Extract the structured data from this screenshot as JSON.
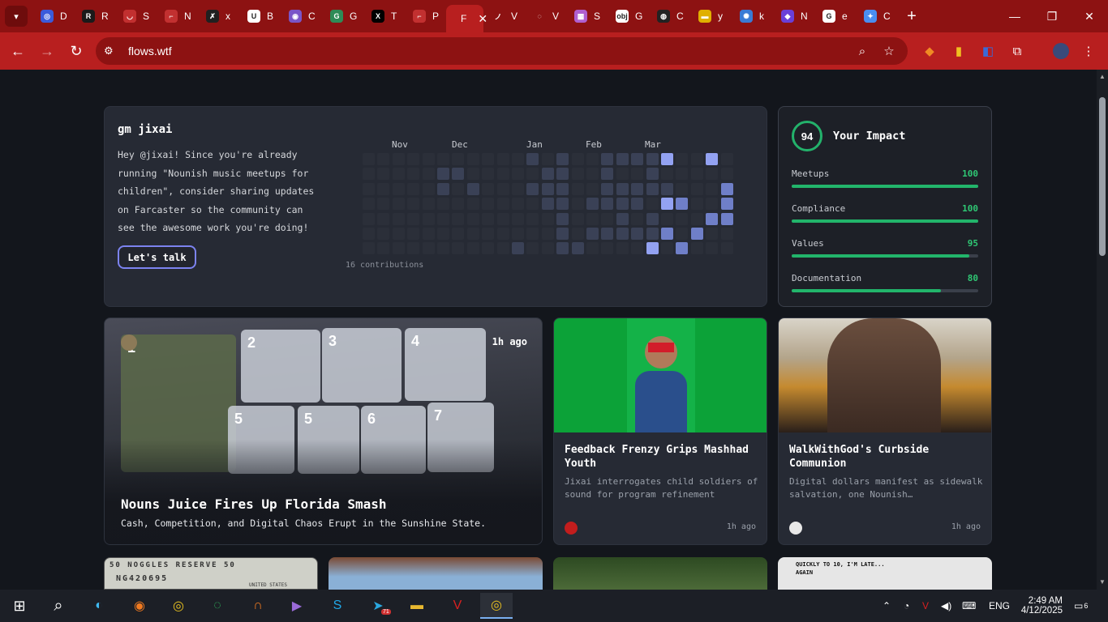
{
  "browser": {
    "tabs": [
      {
        "label": "D",
        "fav_color": "#3b5bdb",
        "fav_text": "◎"
      },
      {
        "label": "R",
        "fav_color": "#1a1a1a",
        "fav_text": "R"
      },
      {
        "label": "S",
        "fav_color": "#c23030",
        "fav_text": "◡"
      },
      {
        "label": "N",
        "fav_color": "#c23030",
        "fav_text": "⌐"
      },
      {
        "label": "x",
        "fav_color": "#202020",
        "fav_text": "✗"
      },
      {
        "label": "B",
        "fav_color": "#ffffff",
        "fav_text": "U"
      },
      {
        "label": "C",
        "fav_color": "#7a55c8",
        "fav_text": "◉"
      },
      {
        "label": "G",
        "fav_color": "#2e8b57",
        "fav_text": "G"
      },
      {
        "label": "T",
        "fav_color": "#000000",
        "fav_text": "X"
      },
      {
        "label": "P",
        "fav_color": "#c23030",
        "fav_text": "⌐"
      },
      {
        "label": "F",
        "fav_color": "#b81f1f",
        "fav_text": "",
        "active": true
      },
      {
        "label": "V",
        "fav_color": "#8d1212",
        "fav_text": "ノ"
      },
      {
        "label": "V",
        "fav_color": "#8d1212",
        "fav_text": "◌"
      },
      {
        "label": "S",
        "fav_color": "#b05fd0",
        "fav_text": "▦"
      },
      {
        "label": "G",
        "fav_color": "#ffffff",
        "fav_text": "obj"
      },
      {
        "label": "C",
        "fav_color": "#222222",
        "fav_text": "◍"
      },
      {
        "label": "y",
        "fav_color": "#e0b000",
        "fav_text": "▬"
      },
      {
        "label": "k",
        "fav_color": "#3a7bd5",
        "fav_text": "✺"
      },
      {
        "label": "N",
        "fav_color": "#6a3fd8",
        "fav_text": "◆"
      },
      {
        "label": "e",
        "fav_color": "#ffffff",
        "fav_text": "G"
      },
      {
        "label": "C",
        "fav_color": "#4a8df0",
        "fav_text": "✦"
      }
    ],
    "active_tab_close": "✕",
    "new_tab": "+",
    "url": "flows.wtf"
  },
  "welcome": {
    "greeting": "gm jixai",
    "message": "Hey @jixai! Since you're already running \"Nounish music meetups for children\", consider sharing updates on Farcaster so the community can see the awesome work you're doing!",
    "cta": "Let's talk",
    "months": [
      "Nov",
      "Dec",
      "Jan",
      "Feb",
      "Mar"
    ],
    "contributions": "16 contributions",
    "levels": [
      [
        0,
        0,
        0,
        0,
        0,
        0,
        0,
        0,
        0,
        0,
        0,
        1,
        0,
        1,
        0,
        0,
        1,
        1,
        1,
        1,
        3,
        0,
        0,
        3,
        0
      ],
      [
        0,
        0,
        0,
        0,
        0,
        1,
        1,
        0,
        0,
        0,
        0,
        0,
        1,
        1,
        0,
        0,
        1,
        0,
        0,
        1,
        0,
        0,
        0,
        0,
        0
      ],
      [
        0,
        0,
        0,
        0,
        0,
        1,
        0,
        1,
        0,
        0,
        0,
        1,
        1,
        1,
        0,
        0,
        1,
        1,
        1,
        1,
        1,
        0,
        0,
        0,
        2
      ],
      [
        0,
        0,
        0,
        0,
        0,
        0,
        0,
        0,
        0,
        0,
        0,
        0,
        1,
        1,
        0,
        1,
        1,
        1,
        1,
        0,
        3,
        2,
        0,
        0,
        2
      ],
      [
        0,
        0,
        0,
        0,
        0,
        0,
        0,
        0,
        0,
        0,
        0,
        0,
        0,
        1,
        0,
        0,
        0,
        1,
        0,
        1,
        0,
        0,
        0,
        2,
        2
      ],
      [
        0,
        0,
        0,
        0,
        0,
        0,
        0,
        0,
        0,
        0,
        0,
        0,
        0,
        1,
        0,
        1,
        1,
        1,
        1,
        1,
        2,
        0,
        2,
        0,
        0
      ],
      [
        0,
        0,
        0,
        0,
        0,
        0,
        0,
        0,
        0,
        0,
        1,
        0,
        0,
        1,
        1,
        0,
        0,
        0,
        0,
        3,
        0,
        2,
        0,
        0,
        0
      ]
    ]
  },
  "impact": {
    "score": "94",
    "title": "Your Impact",
    "metrics": [
      {
        "label": "Meetups",
        "value": "100",
        "fraction": 1.0
      },
      {
        "label": "Compliance",
        "value": "100",
        "fraction": 1.0
      },
      {
        "label": "Values",
        "value": "95",
        "fraction": 0.95
      },
      {
        "label": "Documentation",
        "value": "80",
        "fraction": 0.8
      }
    ]
  },
  "feature": {
    "time": "1h ago",
    "title": "Nouns Juice Fires Up Florida Smash",
    "subtitle": "Cash, Competition, and Digital Chaos Erupt in the Sunshine State.",
    "slot_numbers": [
      "1",
      "2",
      "3",
      "4",
      "5",
      "5",
      "6",
      "7"
    ]
  },
  "posts": [
    {
      "title": "Feedback Frenzy Grips Mashhad Youth",
      "desc": "Jixai interrogates child soldiers of sound for program refinement",
      "time": "1h ago"
    },
    {
      "title": "WalkWithGod's Curbside Communion",
      "desc": "Digital dollars manifest as sidewalk salvation, one Nounish…",
      "time": "1h ago"
    }
  ],
  "bottom_strip": {
    "card1_text_top": "50  NOGGLES  RESERVE  50",
    "card1_text_mid": "NG420695",
    "card1_text_right": "UNITED STATES",
    "card4_text": "QUICKLY TO 10, I'M LATE... AGAIN"
  },
  "taskbar": {
    "lang": "ENG",
    "time": "2:49 AM",
    "date": "4/12/2025",
    "telegram_badge": "71",
    "notif_count": "6"
  },
  "colors": {
    "accent": "#b81f1f",
    "green": "#22b56b",
    "bg": "#13161c",
    "card": "#262a34"
  }
}
